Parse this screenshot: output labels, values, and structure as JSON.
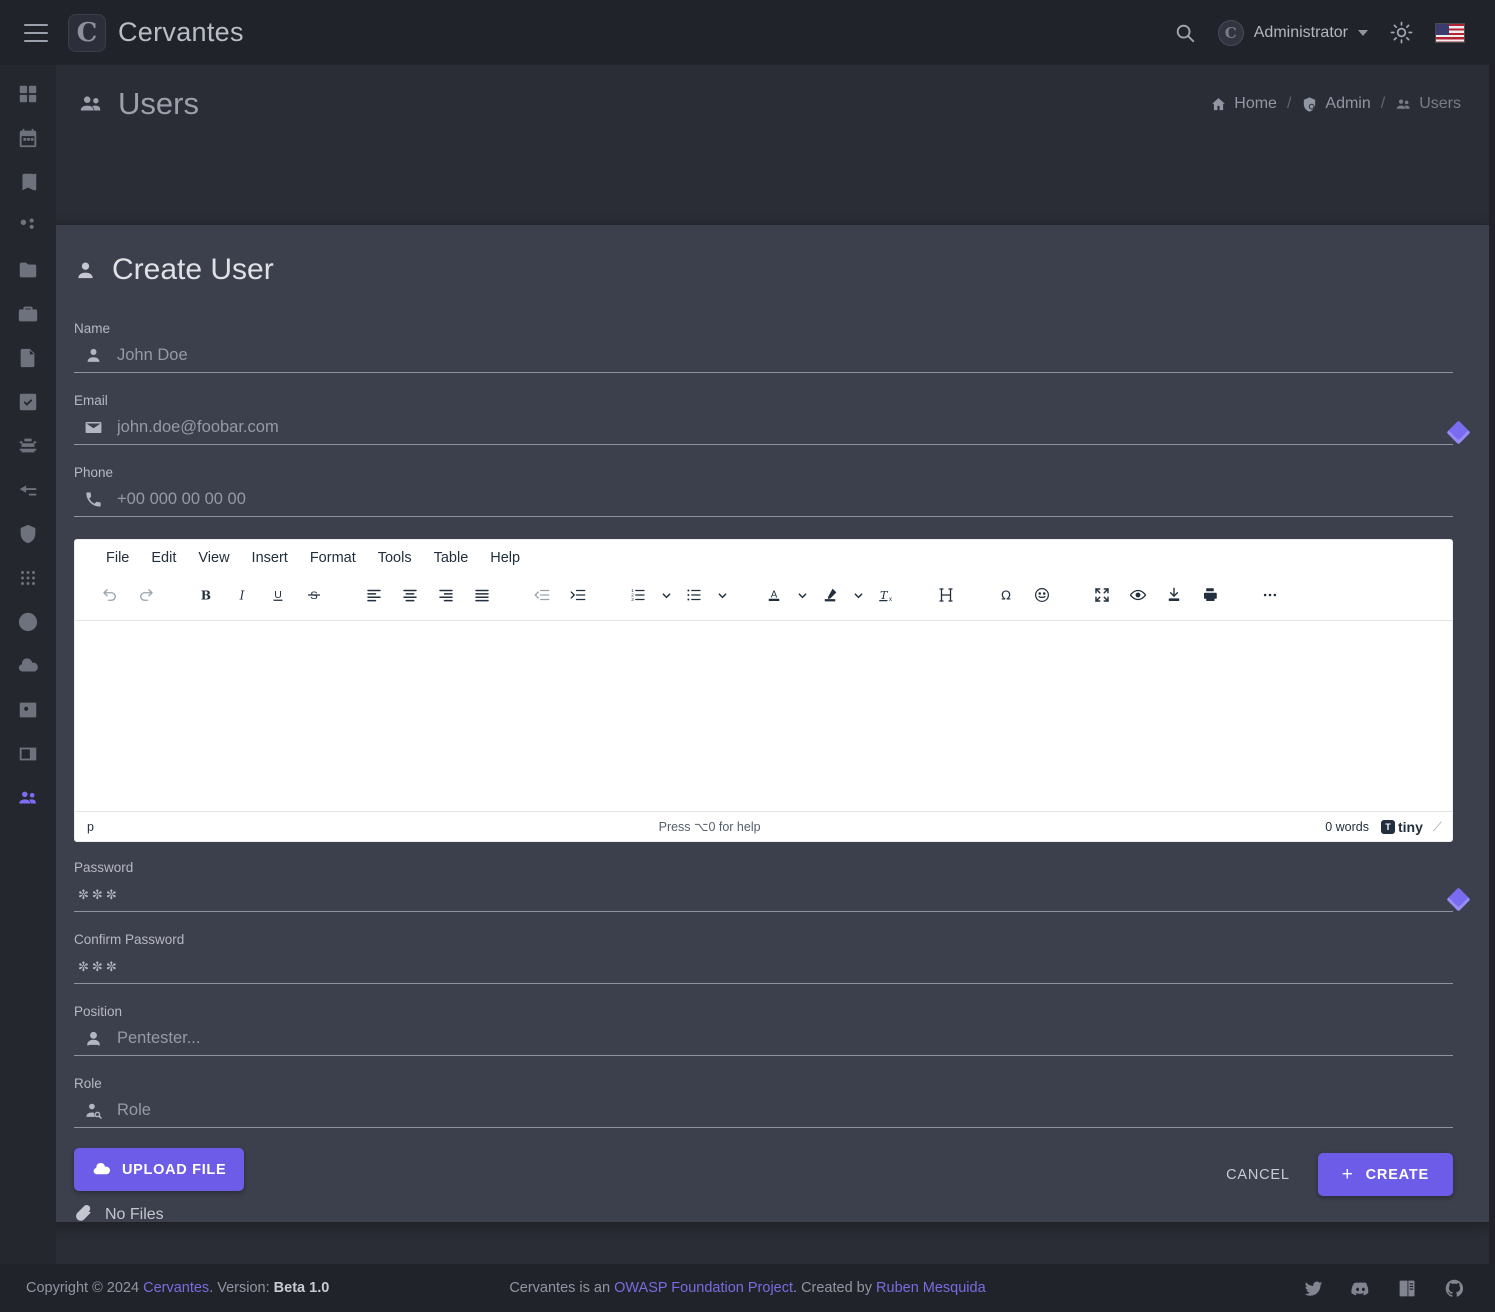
{
  "topbar": {
    "menu_icon": "hamburger-icon",
    "brand": "Cervantes",
    "search_icon": "search-icon",
    "user": "Administrator",
    "theme_icon": "sun-icon",
    "language": "en-US"
  },
  "sidebar": {
    "items": [
      {
        "name": "dashboard",
        "icon": "dashboard-icon"
      },
      {
        "name": "calendar",
        "icon": "calendar-icon"
      },
      {
        "name": "knowledge-base",
        "icon": "book-icon"
      },
      {
        "name": "organizations",
        "icon": "organization-icon"
      },
      {
        "name": "projects",
        "icon": "folder-icon"
      },
      {
        "name": "clients",
        "icon": "briefcase-icon"
      },
      {
        "name": "reports",
        "icon": "document-icon"
      },
      {
        "name": "tasks",
        "icon": "task-check-icon"
      },
      {
        "name": "vulnerabilities",
        "icon": "bug-icon"
      },
      {
        "name": "checklists",
        "icon": "checklist-icon"
      },
      {
        "name": "shield",
        "icon": "shield-icon"
      },
      {
        "name": "apps",
        "icon": "grid-dots-icon"
      },
      {
        "name": "time",
        "icon": "clock-icon"
      },
      {
        "name": "uploads",
        "icon": "cloud-upload-icon"
      },
      {
        "name": "contacts",
        "icon": "id-card-icon"
      },
      {
        "name": "archive",
        "icon": "archive-icon"
      },
      {
        "name": "users",
        "icon": "users-icon",
        "active": true
      }
    ]
  },
  "page": {
    "title": "Users",
    "title_icon": "users-icon",
    "breadcrumb": [
      {
        "label": "Home",
        "icon": "home-icon"
      },
      {
        "label": "Admin",
        "icon": "shield-lock-icon"
      },
      {
        "label": "Users",
        "icon": "users-icon",
        "current": true
      }
    ],
    "breadcrumb_separator": "/"
  },
  "form": {
    "title": "Create User",
    "title_icon": "person-icon",
    "fields": [
      {
        "label": "Name",
        "placeholder": "John Doe",
        "icon": "person-icon",
        "value": ""
      },
      {
        "label": "Email",
        "placeholder": "john.doe@foobar.com",
        "icon": "envelope-icon",
        "value": "",
        "badge": "required-diamond"
      },
      {
        "label": "Phone",
        "placeholder": "+00 000 00 00 00",
        "icon": "phone-icon",
        "value": ""
      }
    ],
    "password": {
      "label": "Password",
      "icon": "password-asterisks-icon",
      "value": "",
      "badge": "required-diamond"
    },
    "confirm_password": {
      "label": "Confirm Password",
      "icon": "password-asterisks-icon",
      "value": ""
    },
    "position": {
      "label": "Position",
      "placeholder": "Pentester...",
      "icon": "person-icon",
      "value": ""
    },
    "role": {
      "label": "Role",
      "placeholder": "Role",
      "icon": "person-search-icon",
      "value": ""
    },
    "upload_label": "UPLOAD FILE",
    "upload_icon": "cloud-upload-icon",
    "no_files_label": "No Files",
    "no_files_icon": "paperclip-icon",
    "cancel_label": "CANCEL",
    "create_label": "CREATE",
    "create_icon": "plus-icon"
  },
  "editor": {
    "menus": [
      "File",
      "Edit",
      "View",
      "Insert",
      "Format",
      "Tools",
      "Table",
      "Help"
    ],
    "toolbar": [
      {
        "name": "undo",
        "icon": "undo-icon"
      },
      {
        "name": "redo",
        "icon": "redo-icon"
      },
      {
        "name": "bold",
        "icon": "bold-icon"
      },
      {
        "name": "italic",
        "icon": "italic-icon"
      },
      {
        "name": "underline",
        "icon": "underline-icon"
      },
      {
        "name": "strikethrough",
        "icon": "strikethrough-icon"
      },
      {
        "name": "align-left",
        "icon": "align-left-icon"
      },
      {
        "name": "align-center",
        "icon": "align-center-icon"
      },
      {
        "name": "align-right",
        "icon": "align-right-icon"
      },
      {
        "name": "align-justify",
        "icon": "align-justify-icon"
      },
      {
        "name": "outdent",
        "icon": "outdent-icon"
      },
      {
        "name": "indent",
        "icon": "indent-icon"
      },
      {
        "name": "numbered-list",
        "icon": "numbered-list-icon"
      },
      {
        "name": "bullet-list",
        "icon": "bullet-list-icon"
      },
      {
        "name": "text-color",
        "icon": "text-color-icon"
      },
      {
        "name": "background-color",
        "icon": "highlighter-icon"
      },
      {
        "name": "clear-formatting",
        "icon": "clear-format-icon"
      },
      {
        "name": "page-break",
        "icon": "page-break-icon"
      },
      {
        "name": "special-character",
        "icon": "omega-icon"
      },
      {
        "name": "emoticons",
        "icon": "smiley-icon"
      },
      {
        "name": "fullscreen",
        "icon": "fullscreen-icon"
      },
      {
        "name": "preview",
        "icon": "eye-icon"
      },
      {
        "name": "export",
        "icon": "download-icon"
      },
      {
        "name": "print",
        "icon": "printer-icon"
      },
      {
        "name": "more",
        "icon": "ellipsis-icon"
      }
    ],
    "content": "",
    "status_path": "p",
    "status_help": "Press ⌥0 for help",
    "status_words": "0 words",
    "branding": "tiny"
  },
  "footer": {
    "copyright_prefix": "Copyright © 2024 ",
    "copyright_link": "Cervantes",
    "version_label": ". Version: ",
    "version_value": "Beta 1.0",
    "center_prefix": "Cervantes is an ",
    "center_link1": "OWASP Foundation Project",
    "center_middle": ". Created by ",
    "center_link2": "Ruben Mesquida",
    "social": [
      {
        "name": "twitter",
        "icon": "twitter-icon"
      },
      {
        "name": "discord",
        "icon": "discord-icon"
      },
      {
        "name": "docs",
        "icon": "book-icon"
      },
      {
        "name": "github",
        "icon": "github-icon"
      }
    ]
  },
  "colors": {
    "accent": "#6c5ce7",
    "background": "#21232b",
    "page": "#2b2d36",
    "card": "#3c3f4c",
    "link": "#7b6bdf"
  }
}
